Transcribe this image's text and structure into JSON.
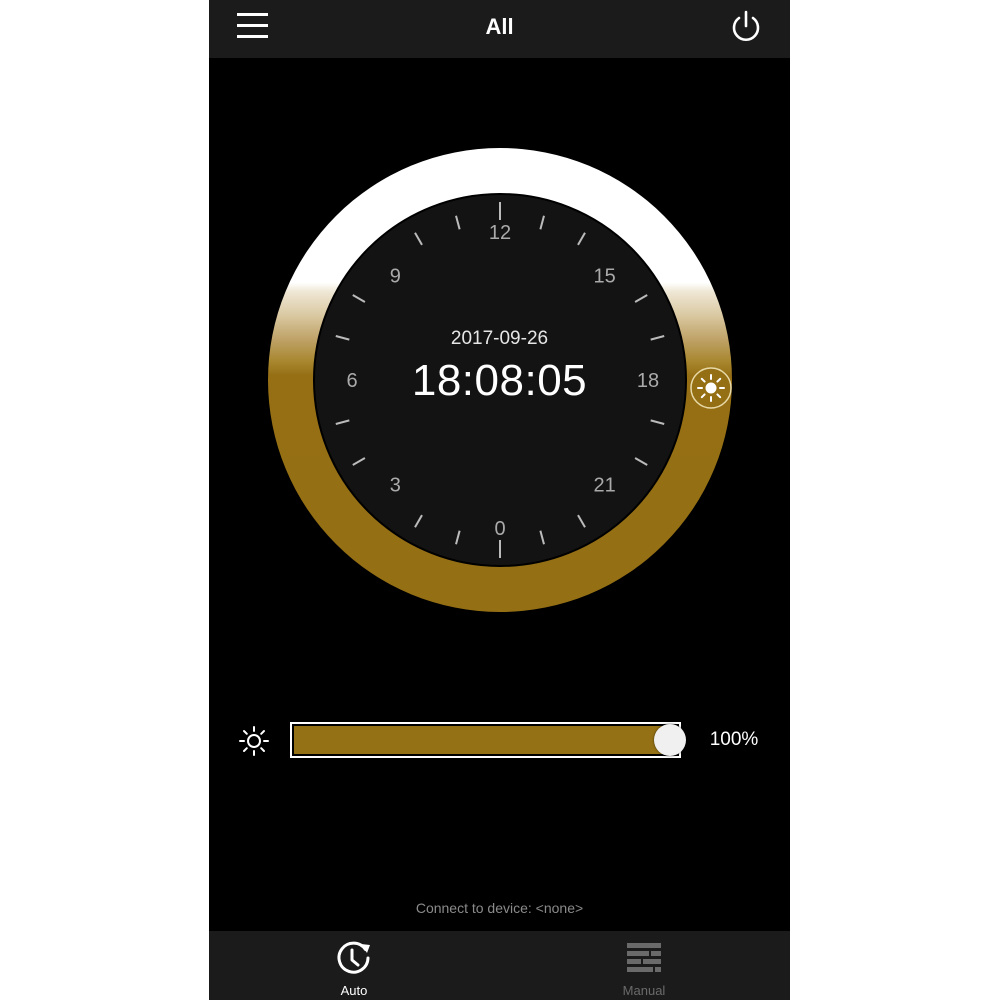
{
  "header": {
    "title": "All",
    "menu_icon": "hamburger-menu-icon",
    "power_icon": "power-icon"
  },
  "dial": {
    "hour_labels": [
      "12",
      "15",
      "18",
      "21",
      "0",
      "3",
      "6",
      "9"
    ],
    "date": "2017-09-26",
    "time": "18:08:05",
    "marker_icon": "sun-icon",
    "colors": {
      "ring_day": "#ffffff",
      "ring_night": "#946f14",
      "face": "#131313",
      "tick": "#bbbbbb",
      "label": "#aaaaaa"
    }
  },
  "brightness": {
    "icon": "brightness-sun-icon",
    "value_percent": 100,
    "label": "100%",
    "fill_color": "#947115"
  },
  "status": {
    "text": "Connect to device: <none>"
  },
  "tabs": [
    {
      "label": "Auto",
      "icon": "clock-refresh-icon",
      "active": true
    },
    {
      "label": "Manual",
      "icon": "sliders-grid-icon",
      "active": false
    }
  ]
}
